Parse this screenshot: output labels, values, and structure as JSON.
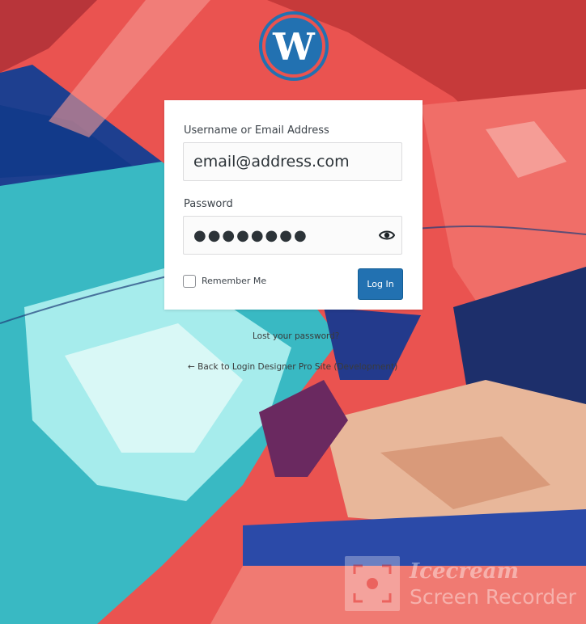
{
  "colors": {
    "primary_button": "#2271b1",
    "wordpress_logo": "#2271b1"
  },
  "login": {
    "username_label": "Username or Email Address",
    "username_value": "email@address.com",
    "password_label": "Password",
    "password_value": "●●●●●●●●",
    "show_password_icon": "eye-icon",
    "remember_label": "Remember Me",
    "remember_checked": false,
    "submit_label": "Log In"
  },
  "links": {
    "lost_password": "Lost your password?",
    "back_to_site": "← Back to Login Designer Pro Site (Development)"
  },
  "watermark": {
    "title": "Icecream",
    "subtitle": "Screen Recorder"
  }
}
